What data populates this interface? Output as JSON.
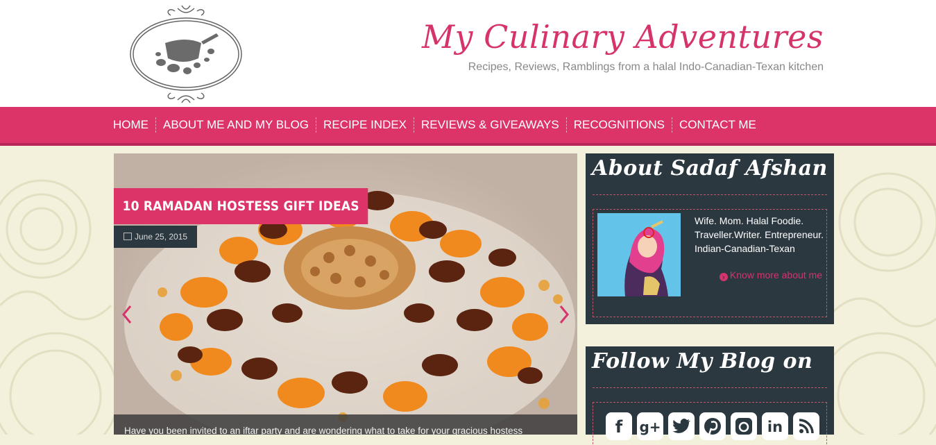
{
  "header": {
    "site_title": "My Culinary Adventures",
    "tagline": "Recipes, Reviews, Ramblings from a halal Indo-Canadian-Texan kitchen",
    "logo_icon": "bowl-logo-icon"
  },
  "nav": {
    "items": [
      {
        "label": "HOME"
      },
      {
        "label": "ABOUT ME AND MY BLOG"
      },
      {
        "label": "RECIPE INDEX"
      },
      {
        "label": "REVIEWS & GIVEAWAYS"
      },
      {
        "label": "RECOGNITIONS"
      },
      {
        "label": "CONTACT ME"
      }
    ]
  },
  "post": {
    "title": "10 RAMADAN HOSTESS GIFT IDEAS",
    "date": "June 25, 2015",
    "excerpt": "Have you been invited to an iftar party and are wondering what to take for your gracious hostess"
  },
  "sidebar": {
    "about": {
      "title": "About Sadaf Afshan",
      "bio": "Wife. Mom. Halal Foodie. Traveller.Writer. Entrepreneur. Indian-Canadian-Texan",
      "link": "Know more about me"
    },
    "follow": {
      "title": "Follow My Blog on",
      "icons": [
        "facebook-icon",
        "google-plus-icon",
        "twitter-icon",
        "pinterest-icon",
        "instagram-icon",
        "linkedin-icon",
        "rss-icon"
      ]
    }
  },
  "colors": {
    "accent": "#dc3369",
    "sidebar_bg": "#2c3840",
    "page_bg": "#f3f0dc"
  }
}
